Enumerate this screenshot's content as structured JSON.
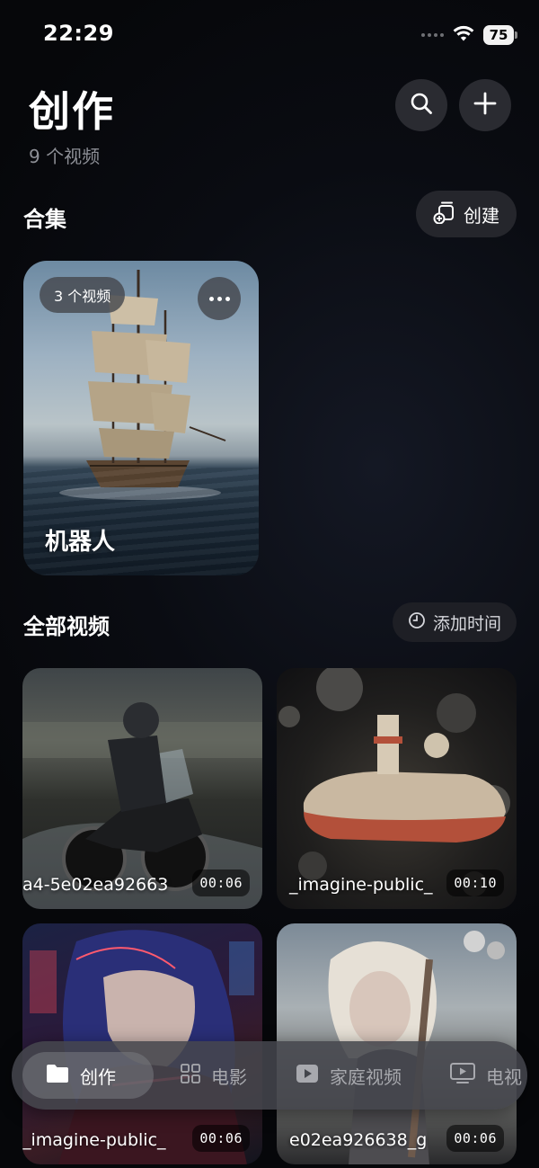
{
  "status_bar": {
    "time": "22:29",
    "battery": "75"
  },
  "header": {
    "title": "创作",
    "subtitle": "9 个视频"
  },
  "collections": {
    "title": "合集",
    "create_label": "创建",
    "items": [
      {
        "count": "3 个视频",
        "name": "机器人"
      }
    ]
  },
  "all_videos": {
    "title": "全部视频",
    "sort_label": "添加时间",
    "items": [
      {
        "name": "a4-5e02ea92663",
        "duration": "00:06"
      },
      {
        "name": "_imagine-public_",
        "duration": "00:10"
      },
      {
        "name": "_imagine-public_",
        "duration": "00:06"
      },
      {
        "name": "e02ea926638_g",
        "duration": "00:06"
      }
    ]
  },
  "tabs": [
    {
      "label": "创作",
      "icon": "folder-icon",
      "active": true
    },
    {
      "label": "电影",
      "icon": "grid-icon",
      "active": false
    },
    {
      "label": "家庭视频",
      "icon": "play-square-icon",
      "active": false
    },
    {
      "label": "电视",
      "icon": "tv-icon",
      "active": false
    }
  ],
  "colors": {
    "background": "#07080c",
    "surface": "#2a2b31",
    "text_secondary": "#8d8f96"
  }
}
